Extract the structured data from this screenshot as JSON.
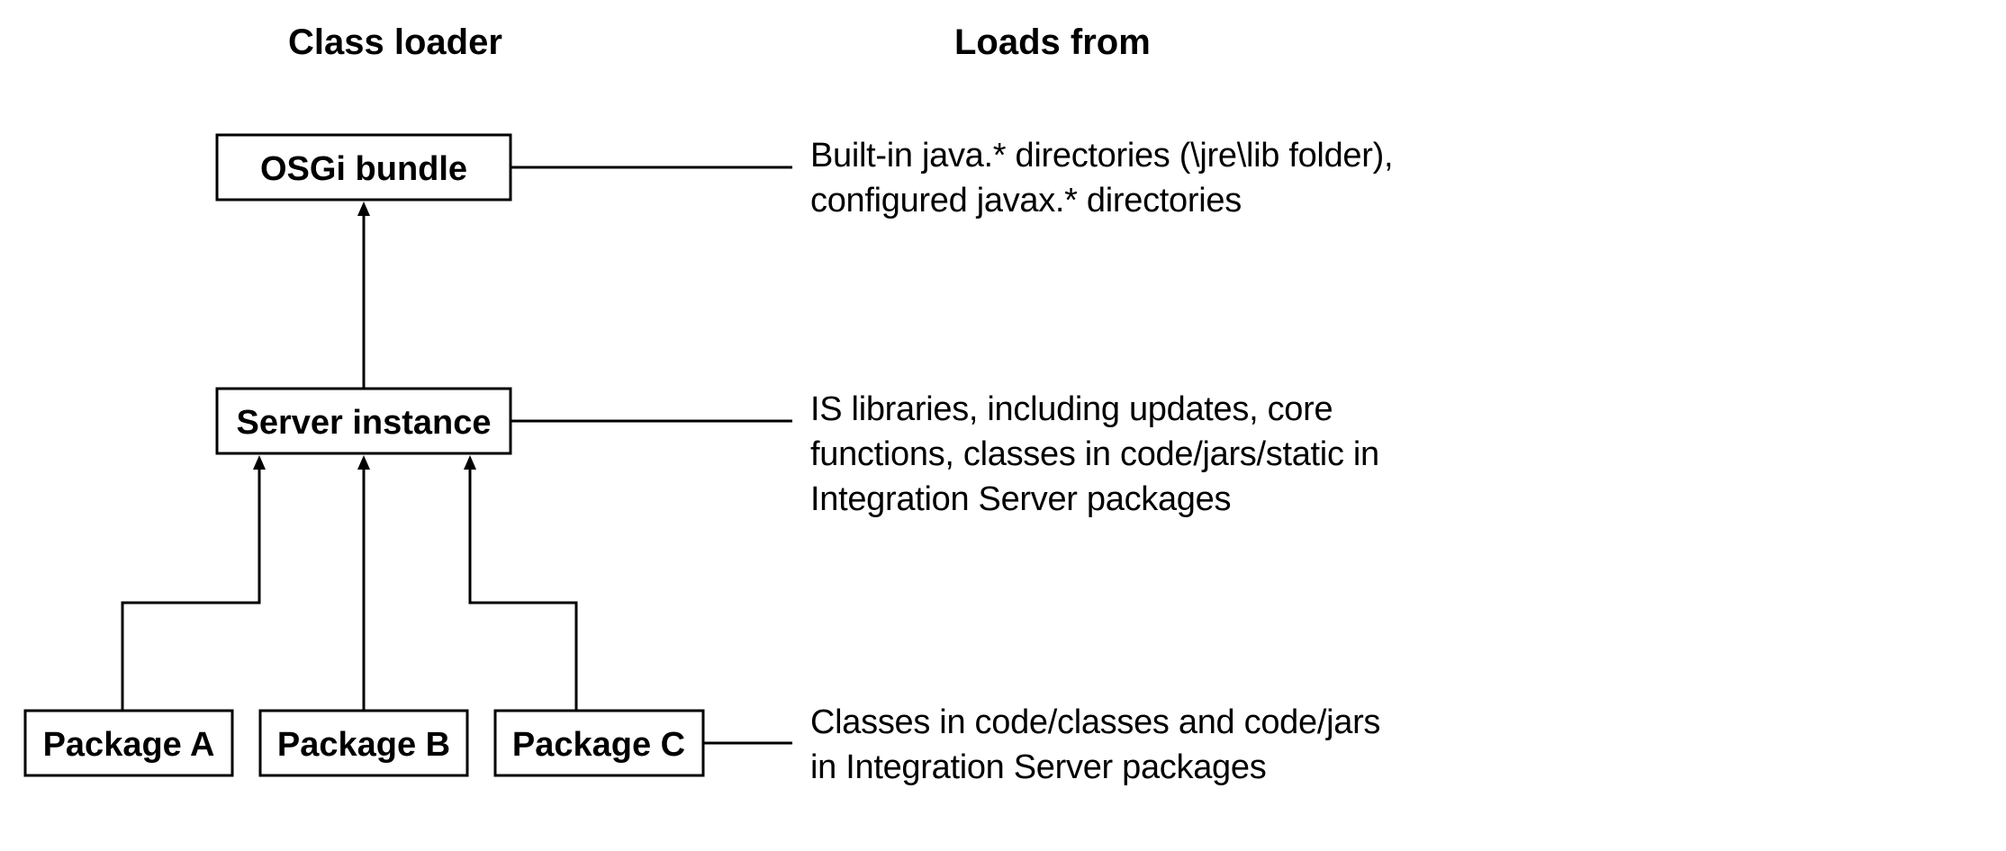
{
  "headings": {
    "left": "Class loader",
    "right": "Loads from"
  },
  "nodes": {
    "osgi": "OSGi bundle",
    "server": "Server instance",
    "pkgA": "Package A",
    "pkgB": "Package B",
    "pkgC": "Package C"
  },
  "descriptions": {
    "osgi": {
      "line1": "Built-in java.* directories (\\jre\\lib folder),",
      "line2": "configured javax.* directories"
    },
    "server": {
      "line1": "IS libraries, including updates, core",
      "line2": "functions, classes in code/jars/static in",
      "line3": "Integration Server packages"
    },
    "packages": {
      "line1": "Classes in code/classes and code/jars",
      "line2": "in Integration Server packages"
    }
  }
}
